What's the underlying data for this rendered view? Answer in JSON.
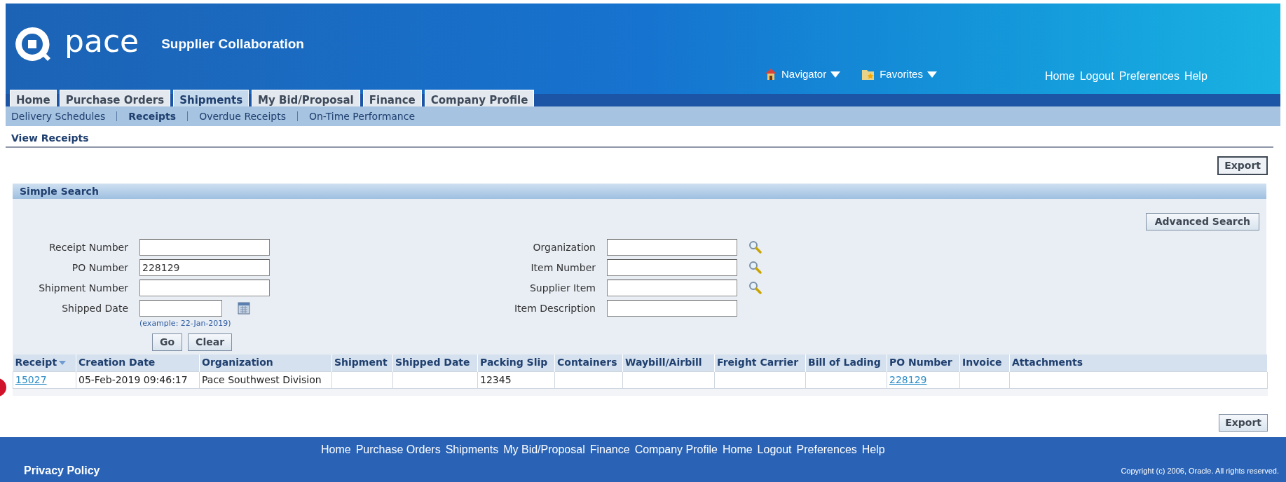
{
  "header": {
    "logo_text": "pace",
    "app_title": "Supplier Collaboration",
    "navigator": "Navigator",
    "favorites": "Favorites",
    "links": [
      "Home",
      "Logout",
      "Preferences",
      "Help"
    ]
  },
  "tabs": [
    {
      "label": "Home",
      "selected": false
    },
    {
      "label": "Purchase Orders",
      "selected": false
    },
    {
      "label": "Shipments",
      "selected": true
    },
    {
      "label": "My Bid/Proposal",
      "selected": false
    },
    {
      "label": "Finance",
      "selected": false
    },
    {
      "label": "Company Profile",
      "selected": false
    }
  ],
  "subtabs": [
    {
      "label": "Delivery Schedules",
      "selected": false
    },
    {
      "label": "Receipts",
      "selected": true
    },
    {
      "label": "Overdue Receipts",
      "selected": false
    },
    {
      "label": "On-Time Performance",
      "selected": false
    }
  ],
  "page_title": "View Receipts",
  "export_top": "Export",
  "search": {
    "title": "Simple Search",
    "advanced_button": "Advanced Search",
    "left_fields": [
      {
        "label": "Receipt Number",
        "kind": "text"
      },
      {
        "label": "PO Number",
        "kind": "text",
        "value": "228129"
      },
      {
        "label": "Shipment Number",
        "kind": "text"
      },
      {
        "label": "Shipped Date",
        "kind": "date"
      }
    ],
    "date_hint": "(example: 22-Jan-2019)",
    "right_fields": [
      {
        "label": "Organization",
        "lookup": true
      },
      {
        "label": "Item Number",
        "lookup": true
      },
      {
        "label": "Supplier Item",
        "lookup": true
      },
      {
        "label": "Item Description",
        "lookup": false
      }
    ],
    "buttons": [
      "Go",
      "Clear"
    ]
  },
  "table": {
    "columns": [
      {
        "label": "Receipt",
        "sorted": true
      },
      {
        "label": "Creation Date",
        "sorted": false
      },
      {
        "label": "Organization",
        "sorted": false
      },
      {
        "label": "Shipment",
        "sorted": false
      },
      {
        "label": "Shipped Date",
        "sorted": false
      },
      {
        "label": "Packing Slip",
        "sorted": false
      },
      {
        "label": "Containers",
        "sorted": false
      },
      {
        "label": "Waybill/Airbill",
        "sorted": false
      },
      {
        "label": "Freight Carrier",
        "sorted": false
      },
      {
        "label": "Bill of Lading",
        "sorted": false
      },
      {
        "label": "PO Number",
        "sorted": false
      },
      {
        "label": "Invoice",
        "sorted": false
      },
      {
        "label": "Attachments",
        "sorted": false
      }
    ],
    "rows": [
      {
        "cells": [
          {
            "text": "15027",
            "link": true
          },
          {
            "text": "05-Feb-2019 09:46:17",
            "link": false
          },
          {
            "text": "Pace Southwest Division",
            "link": false
          },
          {},
          {},
          {
            "text": "12345",
            "link": false
          },
          {},
          {},
          {},
          {},
          {
            "text": "228129",
            "link": true
          },
          {},
          {}
        ]
      }
    ]
  },
  "export_bottom": "Export",
  "footer": {
    "links": [
      "Home",
      "Purchase Orders",
      "Shipments",
      "My Bid/Proposal",
      "Finance",
      "Company Profile",
      "Home",
      "Logout",
      "Preferences",
      "Help"
    ],
    "privacy": "Privacy Policy",
    "copyright": "Copyright (c) 2006, Oracle. All rights reserved."
  }
}
